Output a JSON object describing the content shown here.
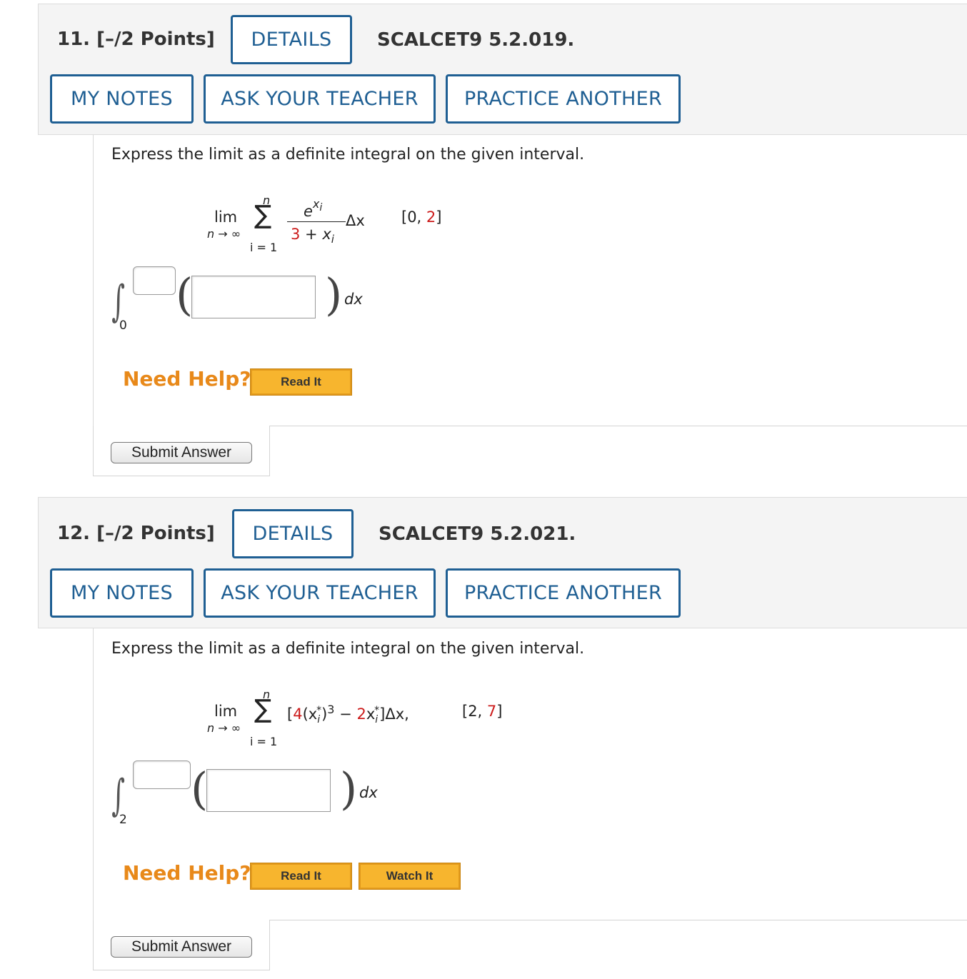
{
  "questions": [
    {
      "number": "11.",
      "points": "[–/2 Points]",
      "details_label": "DETAILS",
      "code": "SCALCET9 5.2.019.",
      "my_notes_label": "MY NOTES",
      "ask_teacher_label": "ASK YOUR TEACHER",
      "practice_label": "PRACTICE ANOTHER",
      "prompt": "Express the limit as a definite integral on the given interval.",
      "limit": {
        "lim": "lim",
        "lim_sub": "n → ∞",
        "sum_top": "n",
        "sum_bottom": "i = 1",
        "numerator": "e",
        "numerator_sup": "x",
        "numerator_sup_sub": "i",
        "denominator_const": "3",
        "denominator_rest": " + x",
        "denominator_sub": "i",
        "delta": "Δx",
        "interval_open": "[0, ",
        "interval_end": "2",
        "interval_close": "]"
      },
      "integral_lower": "0",
      "dx": "dx",
      "need_help": "Need Help?",
      "help_buttons": [
        "Read It"
      ],
      "submit_label": "Submit Answer"
    },
    {
      "number": "12.",
      "points": "[–/2 Points]",
      "details_label": "DETAILS",
      "code": "SCALCET9 5.2.021.",
      "my_notes_label": "MY NOTES",
      "ask_teacher_label": "ASK YOUR TEACHER",
      "practice_label": "PRACTICE ANOTHER",
      "prompt": "Express the limit as a definite integral on the given interval.",
      "limit": {
        "lim": "lim",
        "lim_sub": "n → ∞",
        "sum_top": "n",
        "sum_bottom": "i = 1",
        "open_bracket": "[",
        "coef1": "4",
        "term1": "(x",
        "term1_sub": "i",
        "term1_star": "*",
        "term1_close": ")",
        "term1_sup": "3",
        "minus": " − ",
        "coef2": "2",
        "term2": "x",
        "term2_sub": "i",
        "term2_star": "*",
        "term2_tail": "]Δx,",
        "interval_open": "[2, ",
        "interval_end": "7",
        "interval_close": "]"
      },
      "integral_lower": "2",
      "dx": "dx",
      "need_help": "Need Help?",
      "help_buttons": [
        "Read It",
        "Watch It"
      ],
      "submit_label": "Submit Answer"
    }
  ],
  "colors": {
    "button_border": "#1f5f93",
    "need_help": "#e8891a",
    "help_button": "#f7b52e",
    "highlight": "#cc1b1b"
  }
}
